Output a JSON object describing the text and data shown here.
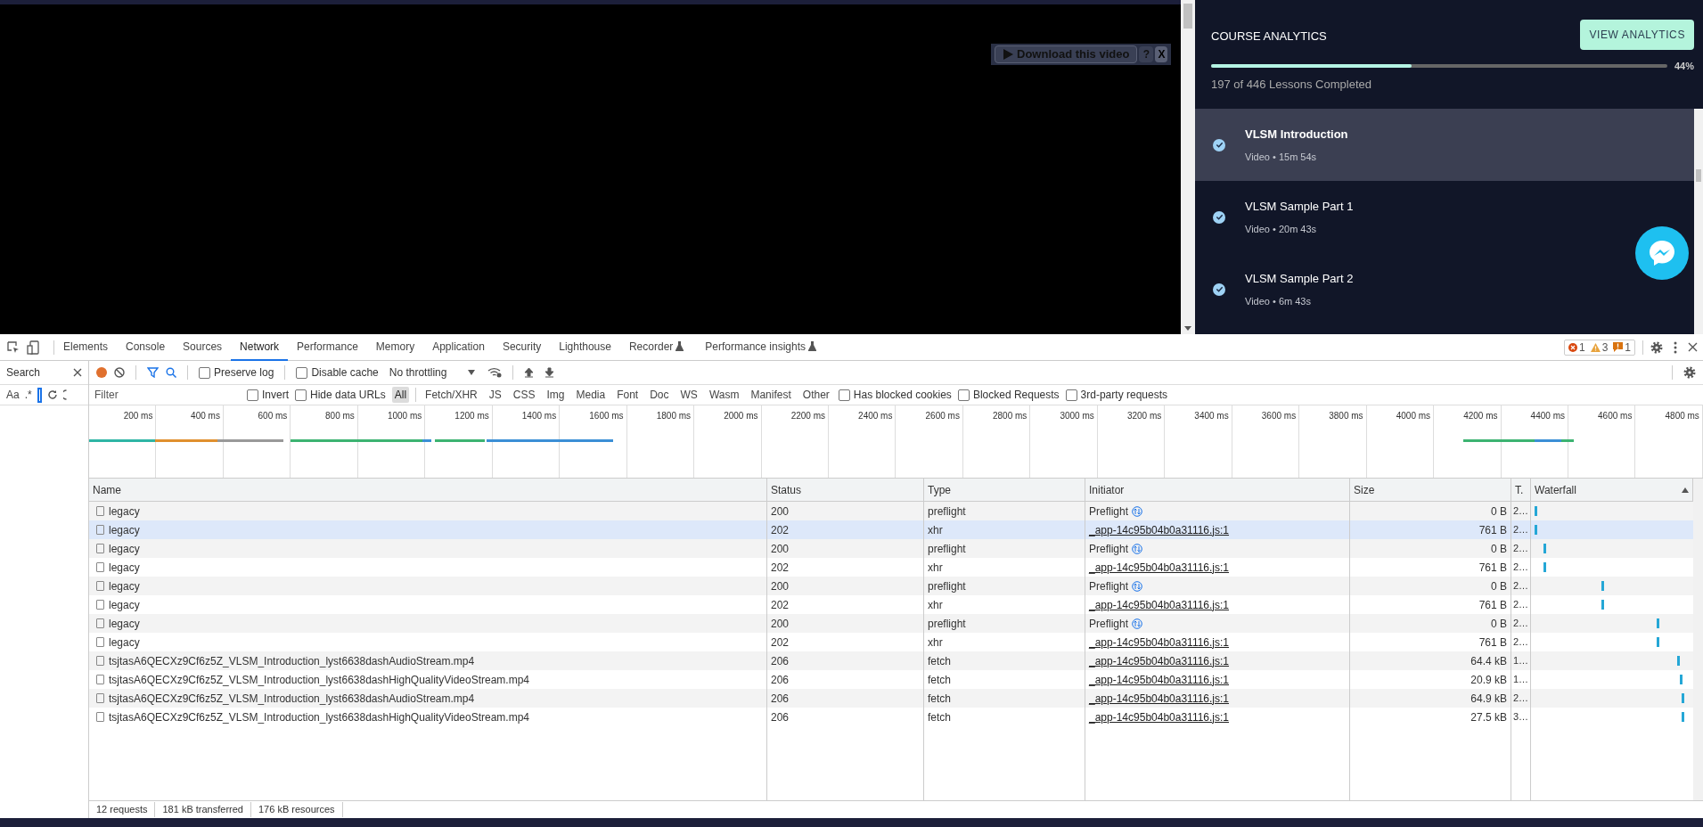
{
  "video": {
    "download_button": "Download this video",
    "help_button": "?",
    "close_button": "X"
  },
  "course": {
    "title": "COURSE ANALYTICS",
    "analytics_button": "VIEW ANALYTICS",
    "progress": {
      "level": 0.44,
      "reading": "44%"
    },
    "summary": "197 of 446 Lessons Completed",
    "lessons": [
      {
        "title": "VLSM Introduction",
        "meta": "Video • 15m 54s",
        "completed": true,
        "selected": true
      },
      {
        "title": "VLSM Sample Part 1",
        "meta": "Video • 20m 43s",
        "completed": true,
        "selected": false
      },
      {
        "title": "VLSM Sample Part 2",
        "meta": "Video • 6m 43s",
        "completed": true,
        "selected": false
      }
    ]
  },
  "devtools": {
    "tabs": [
      {
        "label": "Elements",
        "selected": false,
        "experimental": false
      },
      {
        "label": "Console",
        "selected": false,
        "experimental": false
      },
      {
        "label": "Sources",
        "selected": false,
        "experimental": false
      },
      {
        "label": "Network",
        "selected": true,
        "experimental": false
      },
      {
        "label": "Performance",
        "selected": false,
        "experimental": false
      },
      {
        "label": "Memory",
        "selected": false,
        "experimental": false
      },
      {
        "label": "Application",
        "selected": false,
        "experimental": false
      },
      {
        "label": "Security",
        "selected": false,
        "experimental": false
      },
      {
        "label": "Lighthouse",
        "selected": false,
        "experimental": false
      },
      {
        "label": "Recorder",
        "selected": false,
        "experimental": true
      },
      {
        "label": "Performance insights",
        "selected": false,
        "experimental": true
      }
    ],
    "issues": [
      {
        "kind": "error",
        "count": "1"
      },
      {
        "kind": "warning",
        "count": "3"
      },
      {
        "kind": "issue",
        "count": "1"
      }
    ],
    "search_panel": {
      "title": "Search",
      "case_toggle": "Aa",
      "regex_toggle": ".*"
    },
    "toolbar": {
      "recording": true,
      "preserve_log": {
        "label": "Preserve log",
        "checked": false
      },
      "disable_cache": {
        "label": "Disable cache",
        "checked": false
      },
      "throttling": "No throttling"
    },
    "filter": {
      "placeholder": "Filter",
      "invert": {
        "label": "Invert",
        "checked": false
      },
      "hide_data_urls": {
        "label": "Hide data URLs",
        "checked": false
      },
      "types": [
        {
          "label": "All",
          "selected": true
        },
        {
          "label": "Fetch/XHR",
          "selected": false
        },
        {
          "label": "JS",
          "selected": false
        },
        {
          "label": "CSS",
          "selected": false
        },
        {
          "label": "Img",
          "selected": false
        },
        {
          "label": "Media",
          "selected": false
        },
        {
          "label": "Font",
          "selected": false
        },
        {
          "label": "Doc",
          "selected": false
        },
        {
          "label": "WS",
          "selected": false
        },
        {
          "label": "Wasm",
          "selected": false
        },
        {
          "label": "Manifest",
          "selected": false
        },
        {
          "label": "Other",
          "selected": false
        }
      ],
      "blocked_cookies": {
        "label": "Has blocked cookies",
        "checked": false
      },
      "blocked_requests": {
        "label": "Blocked Requests",
        "checked": false
      },
      "third_party": {
        "label": "3rd-party requests",
        "checked": false
      }
    },
    "timeline": {
      "ticks": [
        "200 ms",
        "400 ms",
        "600 ms",
        "800 ms",
        "1000 ms",
        "1200 ms",
        "1400 ms",
        "1600 ms",
        "1800 ms",
        "2000 ms",
        "2200 ms",
        "2400 ms",
        "2600 ms",
        "2800 ms",
        "3000 ms",
        "3200 ms",
        "3400 ms",
        "3600 ms",
        "3800 ms",
        "4000 ms",
        "4200 ms",
        "4400 ms",
        "4600 ms",
        "4800 ms"
      ]
    },
    "table": {
      "columns": [
        "Name",
        "Status",
        "Type",
        "Initiator",
        "Size",
        "T.",
        "Waterfall"
      ],
      "rows": [
        {
          "name": "legacy",
          "status": "200",
          "type": "preflight",
          "initiator": {
            "text": "Preflight",
            "kind": "preflight"
          },
          "size": "0 B",
          "time": "2…",
          "hovered": false
        },
        {
          "name": "legacy",
          "status": "202",
          "type": "xhr",
          "initiator": {
            "text": "_app-14c95b04b0a31116.js:1",
            "kind": "script"
          },
          "size": "761 B",
          "time": "2…",
          "hovered": true
        },
        {
          "name": "legacy",
          "status": "200",
          "type": "preflight",
          "initiator": {
            "text": "Preflight",
            "kind": "preflight"
          },
          "size": "0 B",
          "time": "2…",
          "hovered": false
        },
        {
          "name": "legacy",
          "status": "202",
          "type": "xhr",
          "initiator": {
            "text": "_app-14c95b04b0a31116.js:1",
            "kind": "script"
          },
          "size": "761 B",
          "time": "2…",
          "hovered": false
        },
        {
          "name": "legacy",
          "status": "200",
          "type": "preflight",
          "initiator": {
            "text": "Preflight",
            "kind": "preflight"
          },
          "size": "0 B",
          "time": "2…",
          "hovered": false
        },
        {
          "name": "legacy",
          "status": "202",
          "type": "xhr",
          "initiator": {
            "text": "_app-14c95b04b0a31116.js:1",
            "kind": "script"
          },
          "size": "761 B",
          "time": "2…",
          "hovered": false
        },
        {
          "name": "legacy",
          "status": "200",
          "type": "preflight",
          "initiator": {
            "text": "Preflight",
            "kind": "preflight"
          },
          "size": "0 B",
          "time": "2…",
          "hovered": false
        },
        {
          "name": "legacy",
          "status": "202",
          "type": "xhr",
          "initiator": {
            "text": "_app-14c95b04b0a31116.js:1",
            "kind": "script"
          },
          "size": "761 B",
          "time": "2…",
          "hovered": false
        },
        {
          "name": "tsjtasA6QECXz9Cf6z5Z_VLSM_Introduction_lyst6638dashAudioStream.mp4",
          "status": "206",
          "type": "fetch",
          "initiator": {
            "text": "_app-14c95b04b0a31116.js:1",
            "kind": "script"
          },
          "size": "64.4 kB",
          "time": "1…",
          "hovered": false
        },
        {
          "name": "tsjtasA6QECXz9Cf6z5Z_VLSM_Introduction_lyst6638dashHighQualityVideoStream.mp4",
          "status": "206",
          "type": "fetch",
          "initiator": {
            "text": "_app-14c95b04b0a31116.js:1",
            "kind": "script"
          },
          "size": "20.9 kB",
          "time": "1…",
          "hovered": false
        },
        {
          "name": "tsjtasA6QECXz9Cf6z5Z_VLSM_Introduction_lyst6638dashAudioStream.mp4",
          "status": "206",
          "type": "fetch",
          "initiator": {
            "text": "_app-14c95b04b0a31116.js:1",
            "kind": "script"
          },
          "size": "64.9 kB",
          "time": "2…",
          "hovered": false
        },
        {
          "name": "tsjtasA6QECXz9Cf6z5Z_VLSM_Introduction_lyst6638dashHighQualityVideoStream.mp4",
          "status": "206",
          "type": "fetch",
          "initiator": {
            "text": "_app-14c95b04b0a31116.js:1",
            "kind": "script"
          },
          "size": "27.5 kB",
          "time": "3…",
          "hovered": false
        }
      ]
    },
    "status_bar": [
      "12 requests",
      "181 kB transferred",
      "176 kB resources"
    ]
  }
}
